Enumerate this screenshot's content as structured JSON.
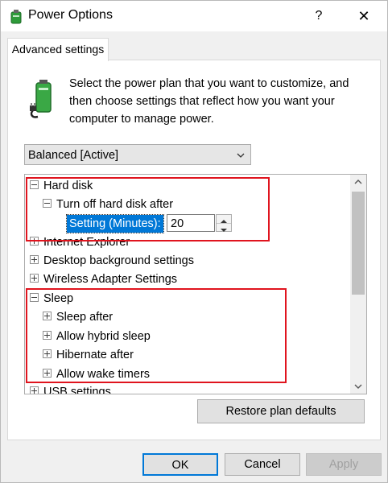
{
  "window": {
    "title": "Power Options",
    "help_label": "?",
    "close_label": "✕"
  },
  "tabs": [
    {
      "label": "Advanced settings",
      "selected": true
    }
  ],
  "description": "Select the power plan that you want to customize, and then choose settings that reflect how you want your computer to manage power.",
  "plan_select": {
    "value": "Balanced [Active]"
  },
  "tree": {
    "items": [
      {
        "label": "Hard disk",
        "expanded": true
      },
      {
        "label": "Turn off hard disk after",
        "expanded": true
      },
      {
        "label": "Internet Explorer",
        "expanded": false
      },
      {
        "label": "Desktop background settings",
        "expanded": false
      },
      {
        "label": "Wireless Adapter Settings",
        "expanded": false
      },
      {
        "label": "Sleep",
        "expanded": true
      },
      {
        "label": "Sleep after",
        "expanded": false
      },
      {
        "label": "Allow hybrid sleep",
        "expanded": false
      },
      {
        "label": "Hibernate after",
        "expanded": false
      },
      {
        "label": "Allow wake timers",
        "expanded": false
      },
      {
        "label": "USB settings",
        "expanded": false
      }
    ],
    "setting_label": "Setting (Minutes):",
    "setting_value": "20"
  },
  "buttons": {
    "restore": "Restore plan defaults",
    "ok": "OK",
    "cancel": "Cancel",
    "apply": "Apply"
  },
  "colors": {
    "highlight": "#0078d7",
    "annotation_red": "#e0141e"
  },
  "icons": {
    "app": "power-options-icon",
    "plan": "battery-plug-icon"
  }
}
